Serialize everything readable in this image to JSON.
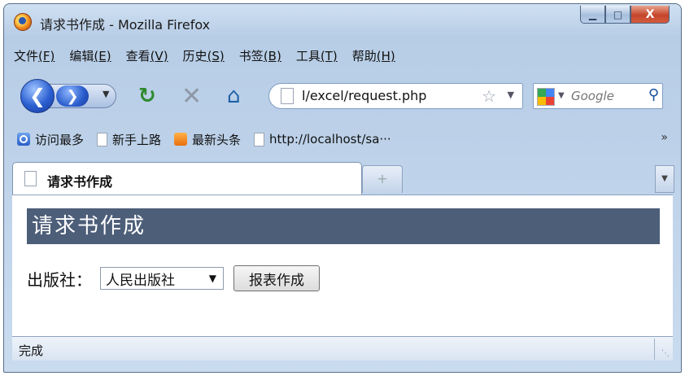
{
  "window": {
    "title": "请求书作成 - Mozilla Firefox",
    "minimize_label": "▁",
    "maximize_label": "□",
    "close_label": "X"
  },
  "menu": {
    "items": [
      {
        "label": "文件",
        "key": "(F)"
      },
      {
        "label": "编辑",
        "key": "(E)"
      },
      {
        "label": "查看",
        "key": "(V)"
      },
      {
        "label": "历史",
        "key": "(S)"
      },
      {
        "label": "书签",
        "key": "(B)"
      },
      {
        "label": "工具",
        "key": "(T)"
      },
      {
        "label": "帮助",
        "key": "(H)"
      }
    ]
  },
  "nav": {
    "url": "l/excel/request.php",
    "search_placeholder": "Google"
  },
  "bookmarks": {
    "items": [
      "访问最多",
      "新手上路",
      "最新头条",
      "http://localhost/sa···"
    ],
    "more": "»"
  },
  "tabs": {
    "active_label": "请求书作成",
    "new_tab": "+"
  },
  "page": {
    "heading": "请求书作成",
    "publisher_label": "出版社：",
    "publisher_selected": "人民出版社",
    "create_button": "报表作成"
  },
  "status": {
    "text": "完成"
  }
}
